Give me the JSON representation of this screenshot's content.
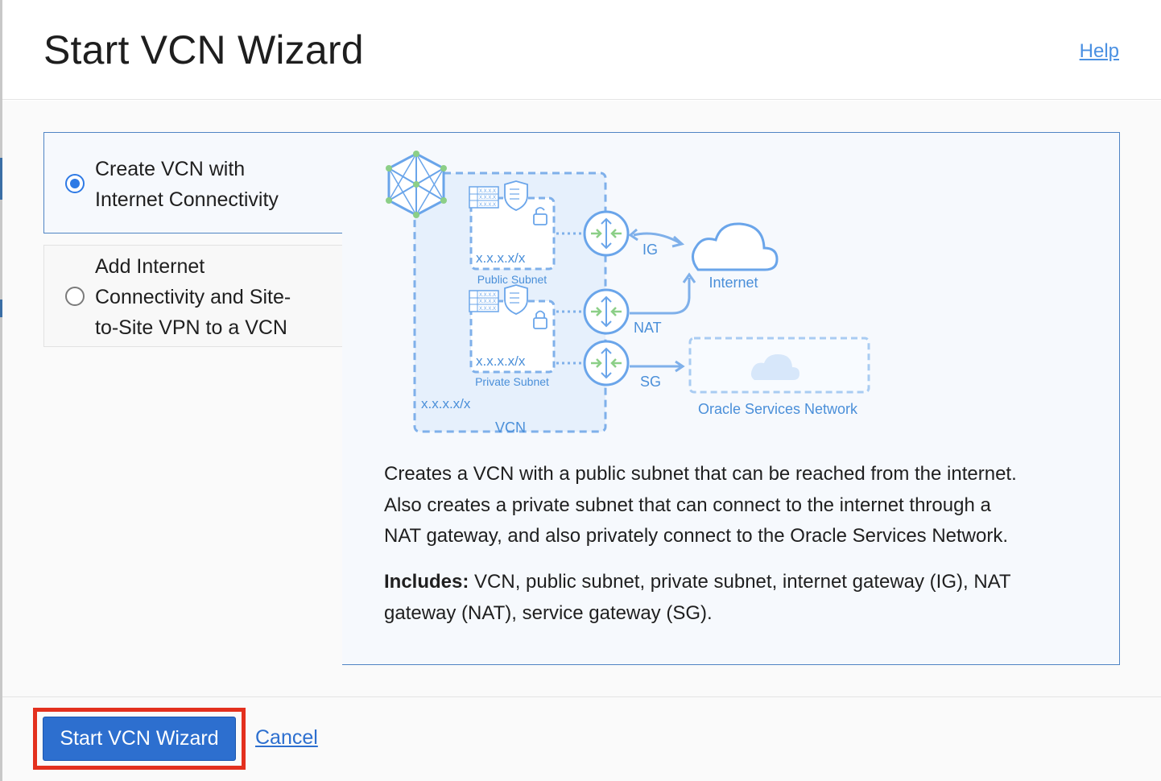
{
  "header": {
    "title": "Start VCN Wizard",
    "help_label": "Help"
  },
  "options": [
    {
      "label_lines": [
        "Create VCN with",
        "Internet Connectivity"
      ],
      "selected": true
    },
    {
      "label_lines": [
        "Add Internet",
        "Connectivity and Site-",
        "to-Site VPN to a VCN"
      ],
      "selected": false
    }
  ],
  "diagram": {
    "public_subnet_cidr": "x.x.x.x/x",
    "public_subnet_label": "Public Subnet",
    "private_subnet_cidr": "x.x.x.x/x",
    "private_subnet_label": "Private Subnet",
    "vcn_cidr": "x.x.x.x/x",
    "vcn_label": "VCN",
    "ig_label": "IG",
    "nat_label": "NAT",
    "sg_label": "SG",
    "internet_label": "Internet",
    "osn_label": "Oracle Services Network",
    "mini_text": "X.X.X.X",
    "colors": {
      "line": "#7fb0ea",
      "fill": "#e6f0fc",
      "accent_green": "#8ccf87",
      "text": "#4a8fd9"
    }
  },
  "description": {
    "lines": [
      "Creates a VCN with a public subnet that can be reached from the internet.",
      "Also creates a private subnet that can connect to the internet through a",
      "NAT gateway, and also privately connect to the Oracle Services Network."
    ],
    "includes_label": "Includes:",
    "includes_lines": [
      " VCN, public subnet, private subnet, internet gateway (IG), NAT",
      "gateway (NAT), service gateway (SG)."
    ]
  },
  "footer": {
    "primary_label": "Start VCN Wizard",
    "cancel_label": "Cancel"
  }
}
